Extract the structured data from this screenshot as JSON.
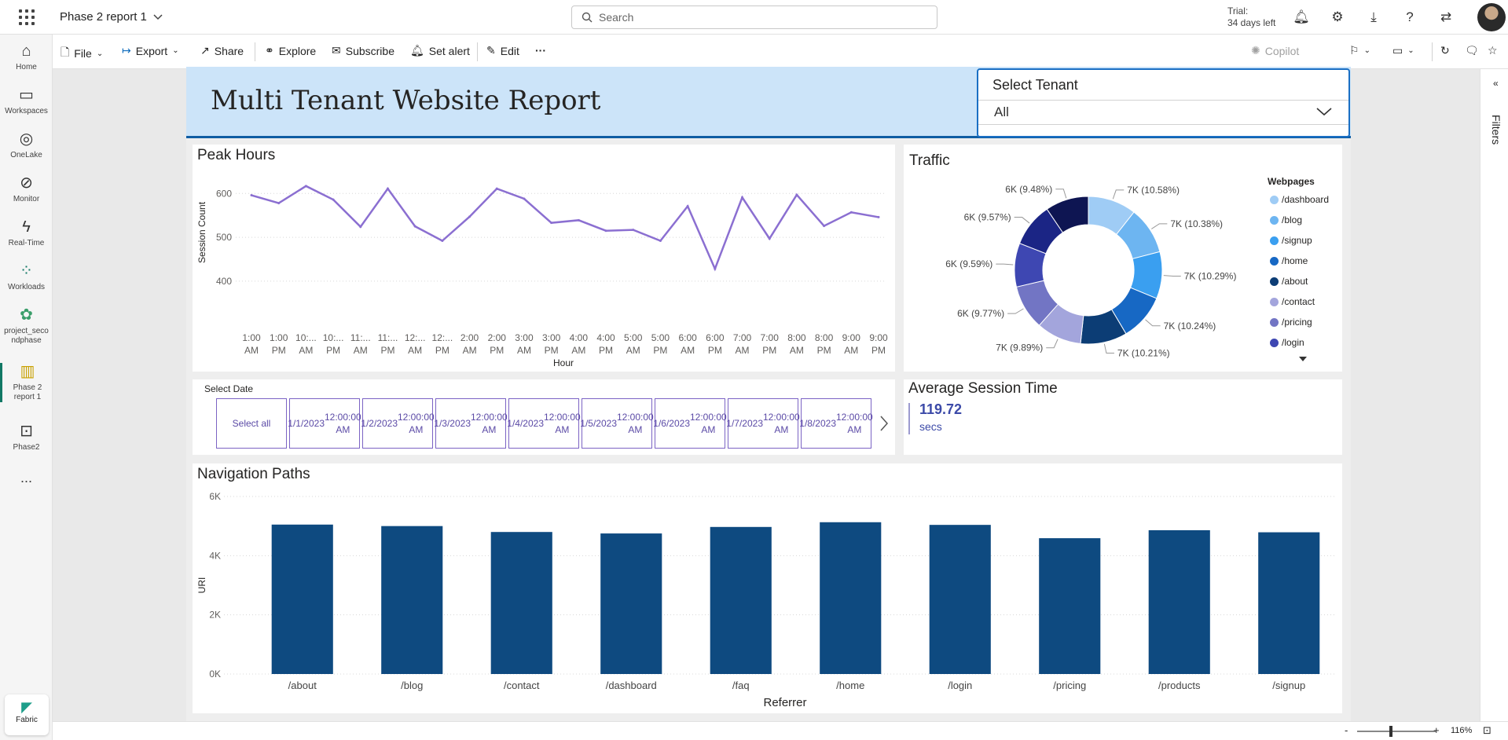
{
  "topbar": {
    "title": "Phase 2 report 1",
    "search_placeholder": "Search",
    "trial_line1": "Trial:",
    "trial_line2": "34 days left"
  },
  "leftnav": {
    "items": [
      {
        "label": "Home",
        "icon": "home-icon"
      },
      {
        "label": "Workspaces",
        "icon": "workspaces-icon"
      },
      {
        "label": "OneLake",
        "icon": "onelake-icon"
      },
      {
        "label": "Monitor",
        "icon": "monitor-icon"
      },
      {
        "label": "Real-Time",
        "icon": "lightning-icon"
      },
      {
        "label": "Workloads",
        "icon": "workloads-icon"
      },
      {
        "label": "project_seco ndphase",
        "icon": "project-icon"
      },
      {
        "label": "Phase 2 report 1",
        "icon": "report-icon"
      },
      {
        "label": "Phase2",
        "icon": "phase2-icon"
      }
    ],
    "more": "...",
    "fabric_label": "Fabric"
  },
  "toolbar": {
    "file": "File",
    "export": "Export",
    "share": "Share",
    "explore": "Explore",
    "subscribe": "Subscribe",
    "set_alert": "Set alert",
    "edit": "Edit",
    "more": "···",
    "copilot": "Copilot"
  },
  "report": {
    "title": "Multi Tenant Website Report",
    "tenant_label": "Select Tenant",
    "tenant_value": "All",
    "peak_hours_title": "Peak Hours",
    "traffic_title": "Traffic",
    "select_date_title": "Select Date",
    "avg_session_title": "Average Session Time",
    "avg_session_value": "119.72",
    "avg_session_unit": "secs",
    "nav_paths_title": "Navigation Paths",
    "select_all": "Select all",
    "date_tiles": [
      {
        "date": "1/1/2023",
        "time": "12:00:00 AM"
      },
      {
        "date": "1/2/2023",
        "time": "12:00:00 AM"
      },
      {
        "date": "1/3/2023",
        "time": "12:00:00 AM"
      },
      {
        "date": "1/4/2023",
        "time": "12:00:00 AM"
      },
      {
        "date": "1/5/2023",
        "time": "12:00:00 AM"
      },
      {
        "date": "1/6/2023",
        "time": "12:00:00 AM"
      },
      {
        "date": "1/7/2023",
        "time": "12:00:00 AM"
      },
      {
        "date": "1/8/2023",
        "time": "12:00:00 AM"
      }
    ],
    "filters_label": "Filters"
  },
  "status": {
    "zoom": "116%"
  },
  "colors": {
    "accent_purple": "#8b6fd1",
    "bar_blue": "#0e4a80",
    "header_band": "#cce4f9"
  },
  "chart_data": [
    {
      "type": "line",
      "title": "Peak Hours",
      "xlabel": "Hour",
      "ylabel": "Session Count",
      "x": [
        "1:00 AM",
        "1:00 PM",
        "10:... AM",
        "10:... PM",
        "11:... AM",
        "11:... PM",
        "12:... AM",
        "12:... PM",
        "2:00 AM",
        "2:00 PM",
        "3:00 AM",
        "3:00 PM",
        "4:00 AM",
        "4:00 PM",
        "5:00 AM",
        "5:00 PM",
        "6:00 AM",
        "6:00 PM",
        "7:00 AM",
        "7:00 PM",
        "8:00 AM",
        "8:00 PM",
        "9:00 AM",
        "9:00 PM"
      ],
      "x_lines": [
        [
          "1:00",
          "AM"
        ],
        [
          "1:00",
          "PM"
        ],
        [
          "10:...",
          "AM"
        ],
        [
          "10:...",
          "PM"
        ],
        [
          "11:...",
          "AM"
        ],
        [
          "11:...",
          "PM"
        ],
        [
          "12:...",
          "AM"
        ],
        [
          "12:...",
          "PM"
        ],
        [
          "2:00",
          "AM"
        ],
        [
          "2:00",
          "PM"
        ],
        [
          "3:00",
          "AM"
        ],
        [
          "3:00",
          "PM"
        ],
        [
          "4:00",
          "AM"
        ],
        [
          "4:00",
          "PM"
        ],
        [
          "5:00",
          "AM"
        ],
        [
          "5:00",
          "PM"
        ],
        [
          "6:00",
          "AM"
        ],
        [
          "6:00",
          "PM"
        ],
        [
          "7:00",
          "AM"
        ],
        [
          "7:00",
          "PM"
        ],
        [
          "8:00",
          "AM"
        ],
        [
          "8:00",
          "PM"
        ],
        [
          "9:00",
          "AM"
        ],
        [
          "9:00",
          "PM"
        ]
      ],
      "series": [
        {
          "values": [
            596,
            578,
            617,
            586,
            524,
            611,
            525,
            492,
            547,
            611,
            588,
            533,
            539,
            515,
            517,
            492,
            571,
            428,
            591,
            497,
            597,
            526,
            557,
            546
          ]
        }
      ],
      "yticks": [
        400,
        500,
        600
      ],
      "ytick_labels": [
        "400",
        "500",
        "600"
      ],
      "ylim": [
        380,
        640
      ],
      "grid": true
    },
    {
      "type": "pie",
      "title": "Traffic",
      "legend_title": "Webpages",
      "legend_placement": "right",
      "slices": [
        {
          "name": "/dashboard",
          "label": "7K (10.58%)",
          "value": 10.58,
          "color": "#9fccf5"
        },
        {
          "name": "/blog",
          "label": "7K (10.38%)",
          "value": 10.38,
          "color": "#6db5f1"
        },
        {
          "name": "/signup",
          "label": "7K (10.29%)",
          "value": 10.29,
          "color": "#3a9ff0"
        },
        {
          "name": "/home",
          "label": "7K (10.24%)",
          "value": 10.24,
          "color": "#1768c4"
        },
        {
          "name": "/about",
          "label": "7K (10.21%)",
          "value": 10.21,
          "color": "#0c3d75"
        },
        {
          "name": "/contact",
          "label": "7K (9.89%)",
          "value": 9.89,
          "color": "#a3a5dc"
        },
        {
          "name": "/pricing",
          "label": "6K (9.77%)",
          "value": 9.77,
          "color": "#7275c4"
        },
        {
          "name": "/login",
          "label": "6K (9.59%)",
          "value": 9.59,
          "color": "#3e47b2"
        },
        {
          "name": "",
          "label": "6K (9.57%)",
          "value": 9.57,
          "color": "#1b2585"
        },
        {
          "name": "",
          "label": "6K (9.48%)",
          "value": 9.48,
          "color": "#0e1552"
        }
      ]
    },
    {
      "type": "bar",
      "title": "Navigation Paths",
      "xlabel": "Referrer",
      "ylabel": "URI",
      "categories": [
        "/about",
        "/blog",
        "/contact",
        "/dashboard",
        "/faq",
        "/home",
        "/login",
        "/pricing",
        "/products",
        "/signup"
      ],
      "values": [
        5050,
        5000,
        4800,
        4750,
        4970,
        5130,
        5040,
        4590,
        4860,
        4790
      ],
      "yticks": [
        0,
        2000,
        4000,
        6000
      ],
      "ytick_labels": [
        "0K",
        "2K",
        "4K",
        "6K"
      ],
      "ylim": [
        0,
        6000
      ],
      "grid": true
    }
  ]
}
